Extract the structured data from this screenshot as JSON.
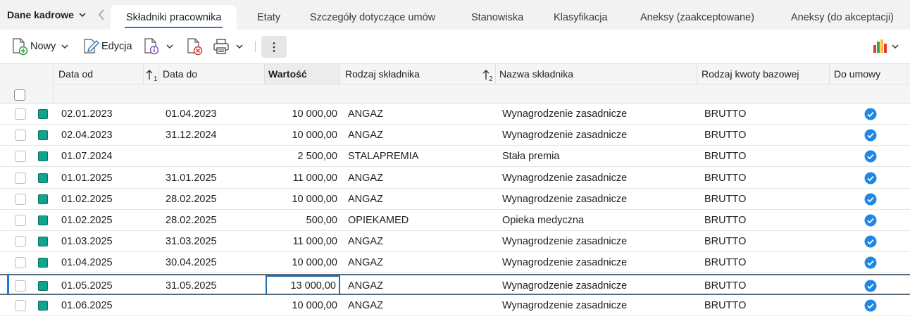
{
  "module": {
    "title": "Dane kadrowe"
  },
  "tabs": [
    {
      "label": "Składniki pracownika",
      "active": true
    },
    {
      "label": "Etaty"
    },
    {
      "label": "Szczegóły dotyczące umów"
    },
    {
      "label": "Stanowiska"
    },
    {
      "label": "Klasyfikacja"
    },
    {
      "label": "Aneksy (zaakceptowane)"
    },
    {
      "label": "Aneksy (do akceptacji)"
    }
  ],
  "toolbar": {
    "new_label": "Nowy",
    "edit_label": "Edycja",
    "icons": [
      "new-document-icon",
      "edit-document-icon",
      "document-info-icon",
      "delete-document-icon",
      "printer-icon",
      "more-vertical-icon",
      "bar-chart-icon"
    ]
  },
  "grid": {
    "columns": [
      "Data od",
      "Data do",
      "Wartość",
      "Rodzaj składnika",
      "Nazwa składnika",
      "Rodzaj kwoty bazowej",
      "Do umowy"
    ],
    "sort_indicators": [
      "1",
      "2"
    ],
    "rows": [
      {
        "from": "02.01.2023",
        "to": "01.04.2023",
        "value": "10 000,00",
        "type": "ANGAZ",
        "name": "Wynagrodzenie zasadnicze",
        "base": "BRUTTO",
        "contract": true
      },
      {
        "from": "02.04.2023",
        "to": "31.12.2024",
        "value": "10 000,00",
        "type": "ANGAZ",
        "name": "Wynagrodzenie zasadnicze",
        "base": "BRUTTO",
        "contract": true
      },
      {
        "from": "01.07.2024",
        "to": "",
        "value": "2 500,00",
        "type": "STALAPREMIA",
        "name": "Stała premia",
        "base": "BRUTTO",
        "contract": true
      },
      {
        "from": "01.01.2025",
        "to": "31.01.2025",
        "value": "11 000,00",
        "type": "ANGAZ",
        "name": "Wynagrodzenie zasadnicze",
        "base": "BRUTTO",
        "contract": true
      },
      {
        "from": "01.02.2025",
        "to": "28.02.2025",
        "value": "10 000,00",
        "type": "ANGAZ",
        "name": "Wynagrodzenie zasadnicze",
        "base": "BRUTTO",
        "contract": true
      },
      {
        "from": "01.02.2025",
        "to": "28.02.2025",
        "value": "500,00",
        "type": "OPIEKAMED",
        "name": "Opieka medyczna",
        "base": "BRUTTO",
        "contract": true
      },
      {
        "from": "01.03.2025",
        "to": "31.03.2025",
        "value": "11 000,00",
        "type": "ANGAZ",
        "name": "Wynagrodzenie zasadnicze",
        "base": "BRUTTO",
        "contract": true
      },
      {
        "from": "01.04.2025",
        "to": "30.04.2025",
        "value": "10 000,00",
        "type": "ANGAZ",
        "name": "Wynagrodzenie zasadnicze",
        "base": "BRUTTO",
        "contract": true
      },
      {
        "from": "01.05.2025",
        "to": "31.05.2025",
        "value": "13 000,00",
        "type": "ANGAZ",
        "name": "Wynagrodzenie zasadnicze",
        "base": "BRUTTO",
        "contract": true,
        "selected": true
      },
      {
        "from": "01.06.2025",
        "to": "",
        "value": "10 000,00",
        "type": "ANGAZ",
        "name": "Wynagrodzenie zasadnicze",
        "base": "BRUTTO",
        "contract": true
      }
    ]
  },
  "colors": {
    "accent": "#1e7bd6",
    "status": "#10a48e",
    "check": "#1e88e5"
  }
}
